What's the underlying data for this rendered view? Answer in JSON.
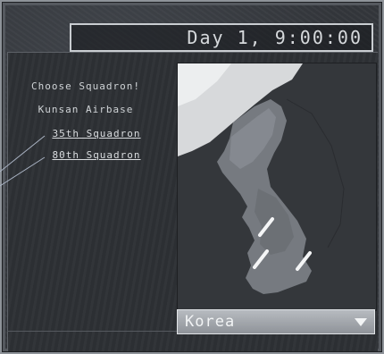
{
  "header": {
    "time_display": "Day 1, 9:00:00"
  },
  "panel": {
    "prompt": "Choose Squadron!",
    "airbase": "Kunsan Airbase"
  },
  "squadrons": [
    {
      "label": "35th Squadron"
    },
    {
      "label": "80th Squadron"
    }
  ],
  "region_selector": {
    "selected": "Korea"
  },
  "map": {
    "base_markers": 3,
    "icon": "airbase-marker-icon"
  },
  "colors": {
    "frame": "#34373c",
    "text": "#d9dcdf",
    "accent": "#c9cdd1"
  }
}
